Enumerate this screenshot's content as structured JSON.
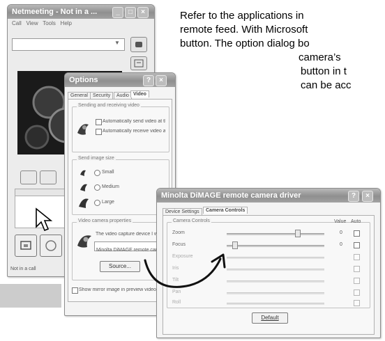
{
  "paragraph": {
    "lines": [
      "Refer to the applications in",
      "remote feed. With Microsoft",
      "button. The option dialog bo",
      "camera’s",
      "button in t",
      "can be acc"
    ]
  },
  "messenger": {
    "title": "Netmeeting - Not in a ...",
    "menu": [
      "Call",
      "View",
      "Tools",
      "Help"
    ],
    "status": "Not in a call"
  },
  "options": {
    "title": "Options",
    "tabs": [
      "General",
      "Security",
      "Audio",
      "Video"
    ],
    "sending_group": "Sending and receiving video",
    "sending_opts": [
      "Automatically send video at the start of each call",
      "Automatically receive video at the start of each call"
    ],
    "size_group": "Send image size",
    "sizes": [
      "Small",
      "Medium",
      "Large"
    ],
    "camera_group": "Video camera properties",
    "camera_text": "The video capture device I want to use is:",
    "device": "Minolta DiMAGE remote camera",
    "source_button": "Source...",
    "footer": "Show mirror image in preview video window"
  },
  "driver": {
    "title": "Minolta DiMAGE remote camera driver",
    "tabs": [
      "Device Settings",
      "Camera Controls"
    ],
    "group": "Camera Controls",
    "col_value": "Value",
    "col_auto": "Auto",
    "rows": [
      "Zoom",
      "Focus",
      "Exposure",
      "Iris",
      "Tilt",
      "Pan",
      "Roll"
    ],
    "default_button": "Default"
  },
  "colors": {
    "title_gradient": "#9a9a9a",
    "window_bg": "#ececec",
    "gray_box": "#cccccc",
    "arrow": "#111111"
  },
  "icons": [
    "close-icon",
    "help-icon",
    "arrow-cursor-icon",
    "curved-arrow-icon",
    "camera-icon",
    "speaker-icon",
    "mic-icon"
  ]
}
